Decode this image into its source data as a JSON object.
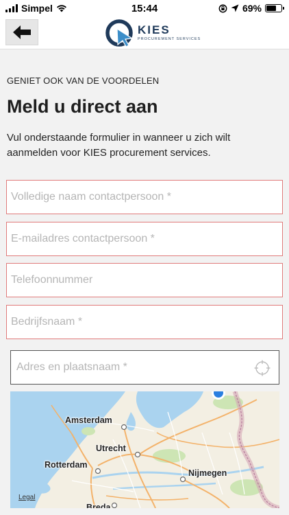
{
  "status": {
    "carrier": "Simpel",
    "time": "15:44",
    "battery_pct": "69%",
    "battery_level": 0.69
  },
  "header": {
    "back_icon": "arrow-left-icon",
    "logo_name": "KIES",
    "logo_sub": "PROCUREMENT SERVICES"
  },
  "content": {
    "eyebrow": "GENIET OOK VAN DE VOORDELEN",
    "title": "Meld u direct aan",
    "intro": "Vul onderstaande formulier in wanneer u zich wilt aanmelden voor KIES procurement services."
  },
  "form": {
    "name_placeholder": "Volledige naam contactpersoon *",
    "email_placeholder": "E-mailadres contactpersoon *",
    "phone_placeholder": "Telefoonnummer",
    "company_placeholder": "Bedrijfsnaam *",
    "address_placeholder": "Adres en plaatsnaam *",
    "error_color": "#e07a7a"
  },
  "map": {
    "cities": [
      "Amsterdam",
      "Utrecht",
      "Rotterdam",
      "Nijmegen",
      "Breda"
    ],
    "legal": "Legal"
  }
}
